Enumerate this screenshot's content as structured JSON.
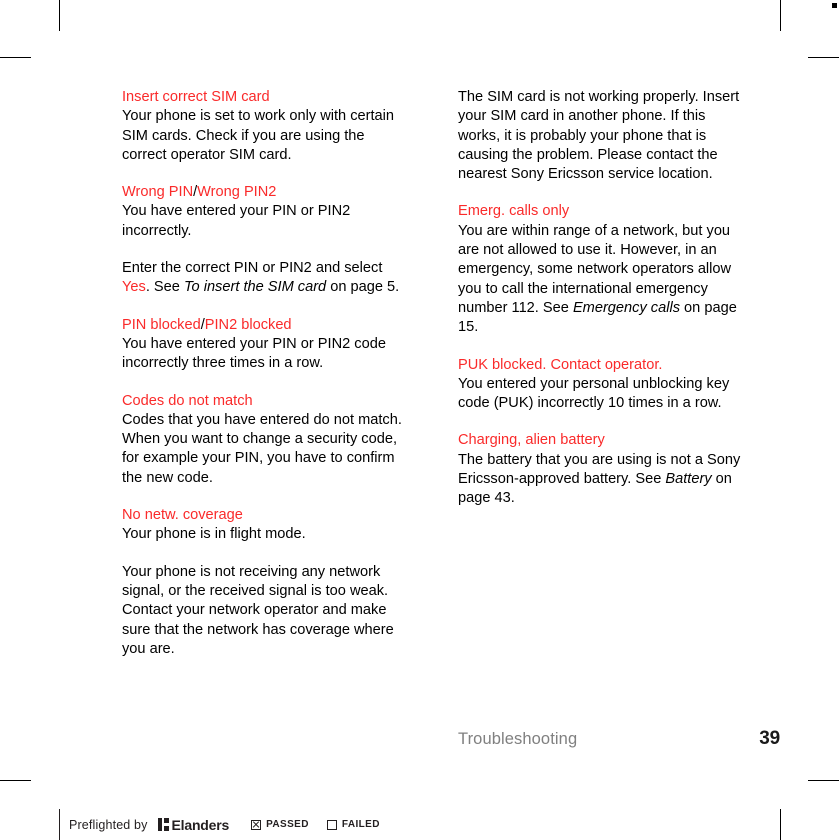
{
  "page": {
    "footer": {
      "section": "Troubleshooting",
      "page_number": "39"
    }
  },
  "left_column": {
    "blocks": [
      {
        "heading": "Insert correct SIM card",
        "body": "Your phone is set to work only with certain SIM cards. Check if you are using the correct operator SIM card."
      },
      {
        "heading_part1": "Wrong PIN",
        "heading_sep": "/",
        "heading_part2": "Wrong PIN2",
        "body": "You have entered your PIN or PIN2 incorrectly."
      },
      {
        "body_pre": "Enter the correct PIN or PIN2 and select ",
        "body_accent": "Yes",
        "body_mid": ". See ",
        "body_italic": "To insert the SIM card",
        "body_post": " on page 5."
      },
      {
        "heading_part1": "PIN blocked",
        "heading_sep": "/",
        "heading_part2": "PIN2 blocked",
        "body": "You have entered your PIN or PIN2 code incorrectly three times in a row."
      },
      {
        "heading": "Codes do not match",
        "body": "Codes that you have entered do not match. When you want to change a security code, for example your PIN, you have to confirm the new code."
      },
      {
        "heading": "No netw. coverage",
        "body": "Your phone is in flight mode."
      },
      {
        "body": "Your phone is not receiving any network signal, or the received signal is too weak. Contact your network operator and make sure that the network has coverage where you are."
      }
    ]
  },
  "right_column": {
    "blocks": [
      {
        "body": "The SIM card is not working properly. Insert your SIM card in another phone. If this works, it is probably your phone that is causing the problem. Please contact the nearest Sony Ericsson service location."
      },
      {
        "heading": "Emerg. calls only",
        "body_pre": "You are within range of a network, but you are not allowed to use it. However, in an emergency, some network operators allow you to call the international emergency number 112. See ",
        "body_italic": "Emergency calls",
        "body_post": " on page 15."
      },
      {
        "heading": "PUK blocked. Contact operator.",
        "body": "You entered your personal unblocking key code (PUK) incorrectly 10 times in a row."
      },
      {
        "heading": "Charging, alien battery",
        "body_pre": "The battery that you are using is not a Sony Ericsson-approved battery. See ",
        "body_italic": "Battery",
        "body_post": " on page 43."
      }
    ]
  },
  "preflight": {
    "label": "Preflighted by",
    "logo_text": "Elanders",
    "passed_label": "PASSED",
    "failed_label": "FAILED"
  },
  "colors": {
    "heading_red": "#fa2a2a",
    "body_black": "#000000",
    "footer_gray": "#808080"
  }
}
